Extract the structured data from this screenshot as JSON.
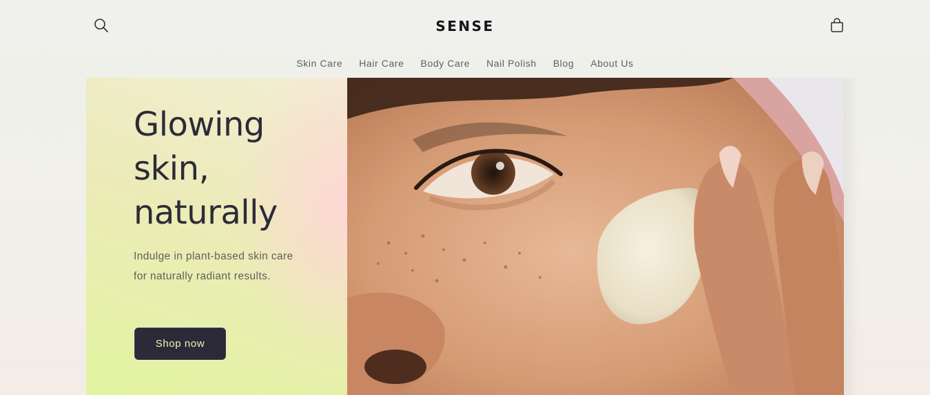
{
  "header": {
    "logo": "SENSE",
    "search_icon": "search-icon",
    "cart_icon": "cart-icon"
  },
  "nav": {
    "items": [
      {
        "label": "Skin Care"
      },
      {
        "label": "Hair Care"
      },
      {
        "label": "Body Care"
      },
      {
        "label": "Nail Polish"
      },
      {
        "label": "Blog"
      },
      {
        "label": "About Us"
      }
    ]
  },
  "hero": {
    "headline": "Glowing skin, naturally",
    "subtext": "Indulge in plant-based skin care for naturally radiant results.",
    "cta_label": "Shop now",
    "image_alt_name": "hero-photo-face-cream"
  },
  "colors": {
    "button_bg": "#2c2a39",
    "button_text": "#f4f2b8",
    "headline": "#2c2b38"
  }
}
